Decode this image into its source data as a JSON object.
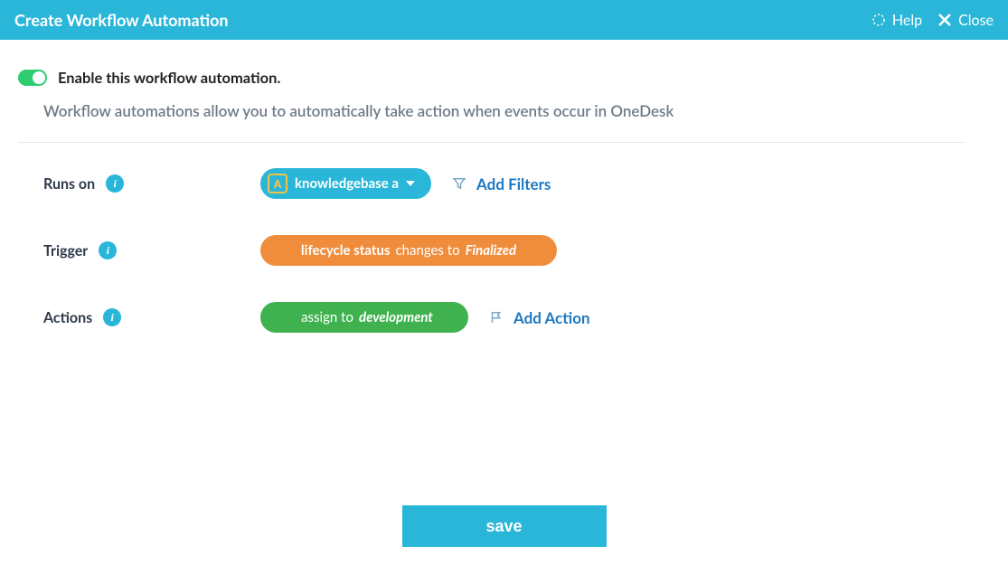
{
  "header": {
    "title": "Create Workflow Automation",
    "help_label": "Help",
    "close_label": "Close"
  },
  "toggle": {
    "label": "Enable this workflow automation.",
    "enabled": true
  },
  "description": "Workflow automations allow you to automatically take action when events occur in OneDesk",
  "config": {
    "runs_on": {
      "label": "Runs on",
      "badge_letter": "A",
      "value": "knowledgebase a",
      "add_filters_label": "Add Filters"
    },
    "trigger": {
      "label": "Trigger",
      "field": "lifecycle status",
      "operator": "changes to",
      "value": "Finalized"
    },
    "actions": {
      "label": "Actions",
      "action_name": "assign to",
      "action_value": "development",
      "add_action_label": "Add Action"
    }
  },
  "footer": {
    "save_label": "save"
  },
  "colors": {
    "accent": "#29b6d8",
    "orange": "#ef8d3c",
    "green": "#3fb24f",
    "toggle_green": "#2ecc71"
  }
}
